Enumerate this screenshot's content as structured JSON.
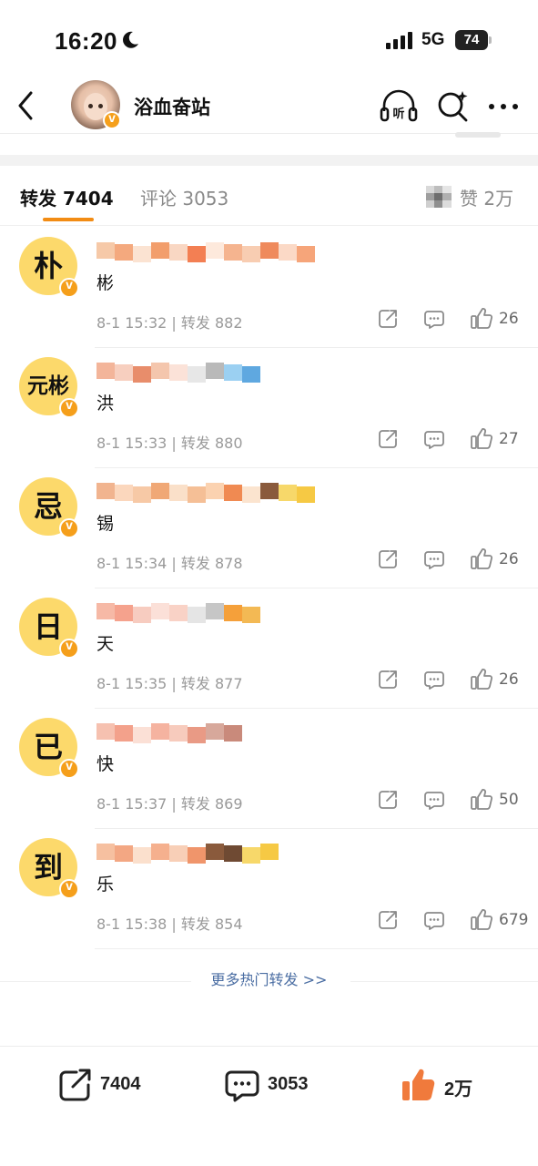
{
  "status_bar": {
    "time": "16:20",
    "network": "5G",
    "battery": "74"
  },
  "header": {
    "title": "浴血奋站"
  },
  "tabs": {
    "repost": "转发 7404",
    "comment": "评论 3053",
    "like": "赞 2万"
  },
  "reposts": [
    {
      "avatar_char": "朴",
      "content": "彬",
      "meta": "8-1 15:32 | 转发 882",
      "likes": "26"
    },
    {
      "avatar_char": "元彬",
      "content": "洪",
      "meta": "8-1 15:33 | 转发 880",
      "likes": "27"
    },
    {
      "avatar_char": "忌",
      "content": "锡",
      "meta": "8-1 15:34 | 转发 878",
      "likes": "26"
    },
    {
      "avatar_char": "日",
      "content": "天",
      "meta": "8-1 15:35 | 转发 877",
      "likes": "26"
    },
    {
      "avatar_char": "已",
      "content": "快",
      "meta": "8-1 15:37 | 转发 869",
      "likes": "50"
    },
    {
      "avatar_char": "到",
      "content": "乐",
      "meta": "8-1 15:38 | 转发 854",
      "likes": "679"
    }
  ],
  "more_hot": "更多热门转发 >>",
  "bottom_bar": {
    "repost": "7404",
    "comment": "3053",
    "like": "2万"
  },
  "colors": {
    "accent": "#f28c14",
    "avatar_bg": "#fcd96b",
    "badge": "#f59f1b",
    "link": "#4b6ea3"
  }
}
